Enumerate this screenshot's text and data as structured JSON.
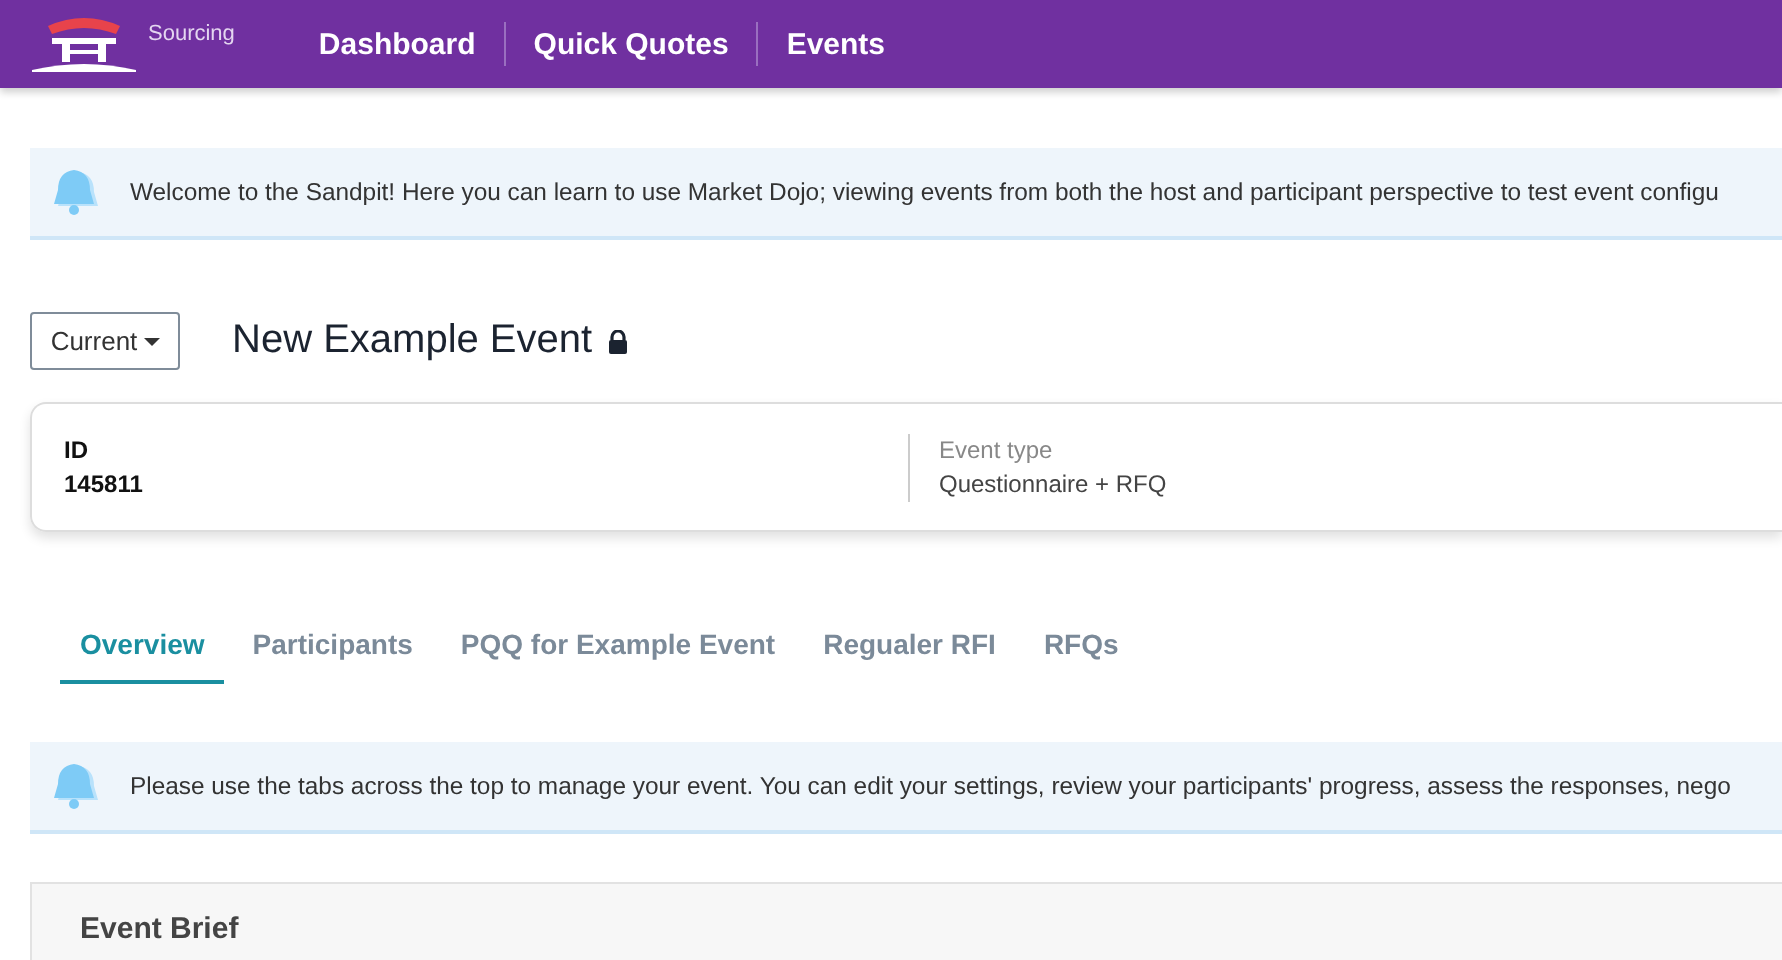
{
  "header": {
    "brand": "Sourcing",
    "nav": [
      {
        "label": "Dashboard"
      },
      {
        "label": "Quick Quotes"
      },
      {
        "label": "Events"
      }
    ]
  },
  "welcome_notice": "Welcome to the Sandpit! Here you can learn to use Market Dojo; viewing events from both the host and participant perspective to test event configu",
  "event": {
    "status_dropdown": "Current",
    "title": "New Example Event",
    "locked": true,
    "details": [
      {
        "label": "ID",
        "value": "145811",
        "kind": "strong"
      },
      {
        "label": "Event type",
        "value": "Questionnaire + RFQ",
        "kind": "muted"
      }
    ]
  },
  "tabs": [
    {
      "label": "Overview",
      "selected": true
    },
    {
      "label": "Participants",
      "selected": false
    },
    {
      "label": "PQQ for Example Event",
      "selected": false
    },
    {
      "label": "Regualer RFI",
      "selected": false
    },
    {
      "label": "RFQs",
      "selected": false
    }
  ],
  "tab_notice": "Please use the tabs across the top to manage your event. You can edit your settings, review your participants' progress, assess the responses, nego",
  "brief": {
    "title": "Event Brief"
  }
}
